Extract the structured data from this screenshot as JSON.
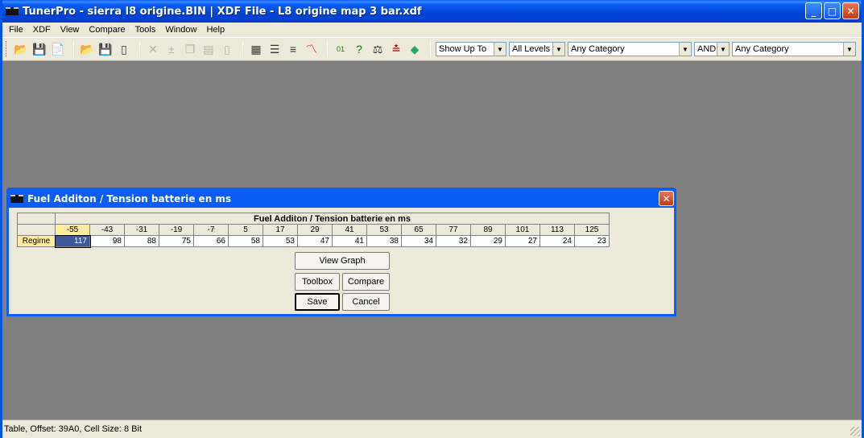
{
  "window": {
    "title": "TunerPro - sierra l8 origine.BIN | XDF File - L8 origine map 3 bar.xdf",
    "minimize": "_",
    "maximize": "□",
    "close": "✕"
  },
  "menu": [
    "File",
    "XDF",
    "View",
    "Compare",
    "Tools",
    "Window",
    "Help"
  ],
  "toolbar": {
    "icons": [
      "open-folder-icon",
      "save-icon",
      "open-bin-icon",
      "open-xdf-icon",
      "save-xdf-icon",
      "new-icon",
      "cut-icon",
      "insert-icon",
      "copy-icon",
      "paste-icon",
      "blank-icon",
      "table-icon",
      "list-icon",
      "text-icon",
      "graph-icon",
      "binary-icon",
      "help-icon",
      "compare-icon",
      "adjust-icon",
      "chip-icon"
    ],
    "show_up_to": "Show Up To",
    "levels": "All Levels",
    "category1": "Any Category",
    "logic": "AND",
    "category2": "Any Category"
  },
  "child": {
    "title": "Fuel Additon / Tension batterie en ms",
    "table_caption": "Fuel Additon / Tension batterie en ms",
    "row_label": "Regime",
    "columns": [
      "-55",
      "-43",
      "-31",
      "-19",
      "-7",
      "5",
      "17",
      "29",
      "41",
      "53",
      "65",
      "77",
      "89",
      "101",
      "113",
      "125"
    ],
    "values": [
      "117",
      "98",
      "88",
      "75",
      "66",
      "58",
      "53",
      "47",
      "41",
      "38",
      "34",
      "32",
      "29",
      "27",
      "24",
      "23"
    ],
    "buttons": {
      "view_graph": "View Graph",
      "toolbox": "Toolbox",
      "compare": "Compare",
      "save": "Save",
      "cancel": "Cancel"
    }
  },
  "status": {
    "text": "Table, Offset: 39A0,  Cell Size: 8 Bit"
  }
}
